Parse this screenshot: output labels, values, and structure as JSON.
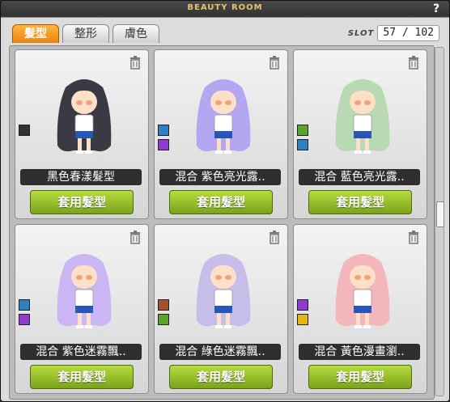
{
  "window": {
    "title": "BEAUTY ROOM",
    "help": "?"
  },
  "tabs": [
    {
      "label": "髮型",
      "active": true
    },
    {
      "label": "整形",
      "active": false
    },
    {
      "label": "膚色",
      "active": false
    }
  ],
  "slot": {
    "label": "SLOT",
    "value": "57 / 102"
  },
  "cards": [
    {
      "name": "黑色春漾髮型",
      "apply": "套用髮型",
      "hair_color": "#3a3a44",
      "swatches": [
        "#333333"
      ]
    },
    {
      "name": "混合 紫色亮光露..",
      "apply": "套用髮型",
      "hair_color": "#b4a6f0",
      "swatches": [
        "#2f7fc3",
        "#8f3bd1"
      ]
    },
    {
      "name": "混合 藍色亮光露..",
      "apply": "套用髮型",
      "hair_color": "#b9d8b4",
      "swatches": [
        "#5aa32c",
        "#2f7fc3"
      ]
    },
    {
      "name": "混合 紫色迷霧飄..",
      "apply": "套用髮型",
      "hair_color": "#c9b6f2",
      "swatches": [
        "#2f7fc3",
        "#8f3bd1"
      ]
    },
    {
      "name": "混合 綠色迷霧飄..",
      "apply": "套用髮型",
      "hair_color": "#c6bde8",
      "swatches": [
        "#a0522d",
        "#5aa32c"
      ]
    },
    {
      "name": "混合 黃色漫畫瀏..",
      "apply": "套用髮型",
      "hair_color": "#f3b6bb",
      "swatches": [
        "#8f3bd1",
        "#e3b80f"
      ]
    }
  ]
}
